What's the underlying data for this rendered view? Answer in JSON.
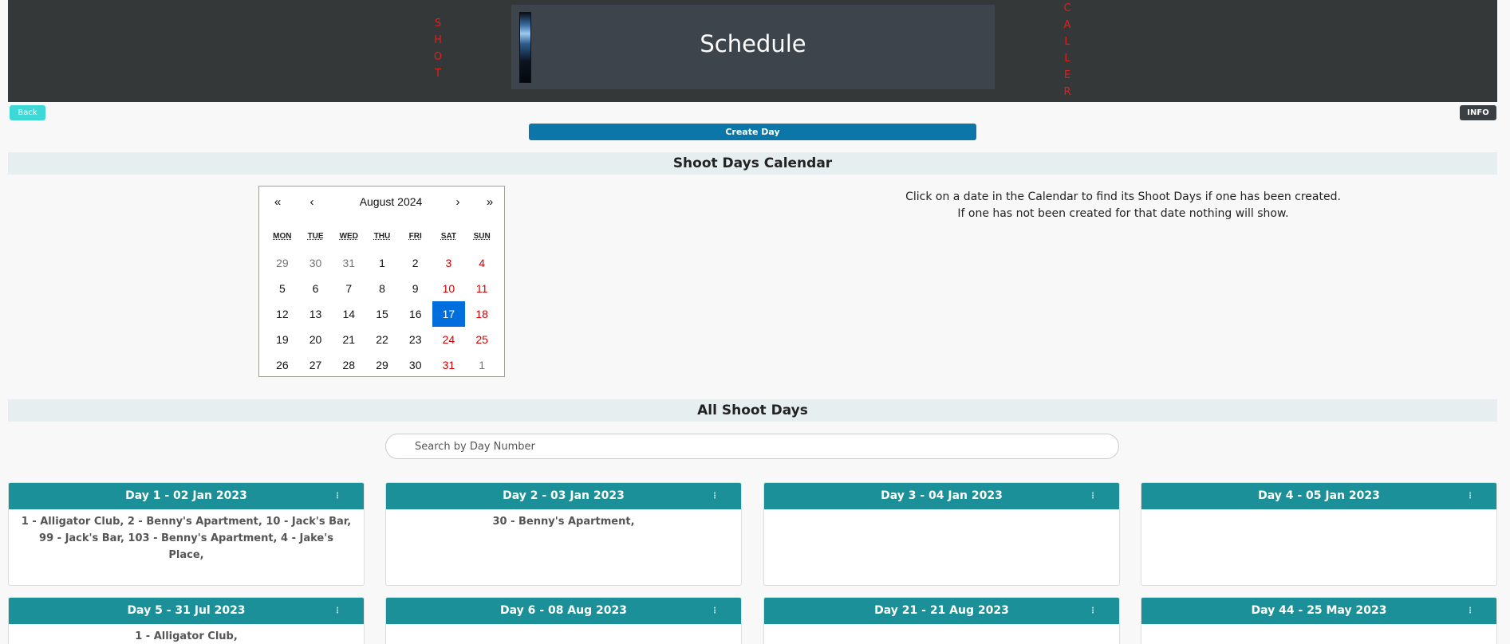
{
  "header": {
    "title": "Schedule",
    "left_vertical": [
      "S",
      "H",
      "O",
      "T"
    ],
    "right_vertical": [
      "C",
      "A",
      "L",
      "L",
      "E",
      "R"
    ]
  },
  "buttons": {
    "back": "Back",
    "info": "INFO",
    "create_day": "Create Day"
  },
  "calendar_section": {
    "title": "Shoot Days Calendar",
    "info_line1": "Click on a date in the Calendar to find its Shoot Days if one has been created.",
    "info_line2": "If one has not been created for that date nothing will show."
  },
  "calendar": {
    "nav": {
      "prev2": "«",
      "prev": "‹",
      "next": "›",
      "next2": "»"
    },
    "month_label": "August 2024",
    "weekdays": [
      "MON",
      "TUE",
      "WED",
      "THU",
      "FRI",
      "SAT",
      "SUN"
    ],
    "weeks": [
      [
        "29",
        "30",
        "31",
        "1",
        "2",
        "3",
        "4"
      ],
      [
        "5",
        "6",
        "7",
        "8",
        "9",
        "10",
        "11"
      ],
      [
        "12",
        "13",
        "14",
        "15",
        "16",
        "17",
        "18"
      ],
      [
        "19",
        "20",
        "21",
        "22",
        "23",
        "24",
        "25"
      ],
      [
        "26",
        "27",
        "28",
        "29",
        "30",
        "31",
        "1"
      ]
    ],
    "selected_day": "17"
  },
  "all_days_section": {
    "title": "All Shoot Days",
    "search_placeholder": "Search by Day Number"
  },
  "days": [
    {
      "title": "Day 1 - 02 Jan 2023",
      "menu": "⋮",
      "scenes": "1 - Alligator Club, 2 - Benny's Apartment, 10 - Jack's Bar, 99 - Jack's Bar, 103 - Benny's Apartment, 4 - Jake's Place,"
    },
    {
      "title": "Day 2 - 03 Jan 2023",
      "menu": "⋮",
      "scenes": "30 - Benny's Apartment,"
    },
    {
      "title": "Day 3 - 04 Jan 2023",
      "menu": "⋮",
      "scenes": ""
    },
    {
      "title": "Day 4 - 05 Jan 2023",
      "menu": "⋮",
      "scenes": ""
    },
    {
      "title": "Day 5 - 31 Jul 2023",
      "menu": "⋮",
      "scenes": "1 - Alligator Club,"
    },
    {
      "title": "Day 6 - 08 Aug 2023",
      "menu": "⋮",
      "scenes": ""
    },
    {
      "title": "Day 21 - 21 Aug 2023",
      "menu": "⋮",
      "scenes": ""
    },
    {
      "title": "Day 44 - 25 May 2023",
      "menu": "⋮",
      "scenes": ""
    }
  ]
}
